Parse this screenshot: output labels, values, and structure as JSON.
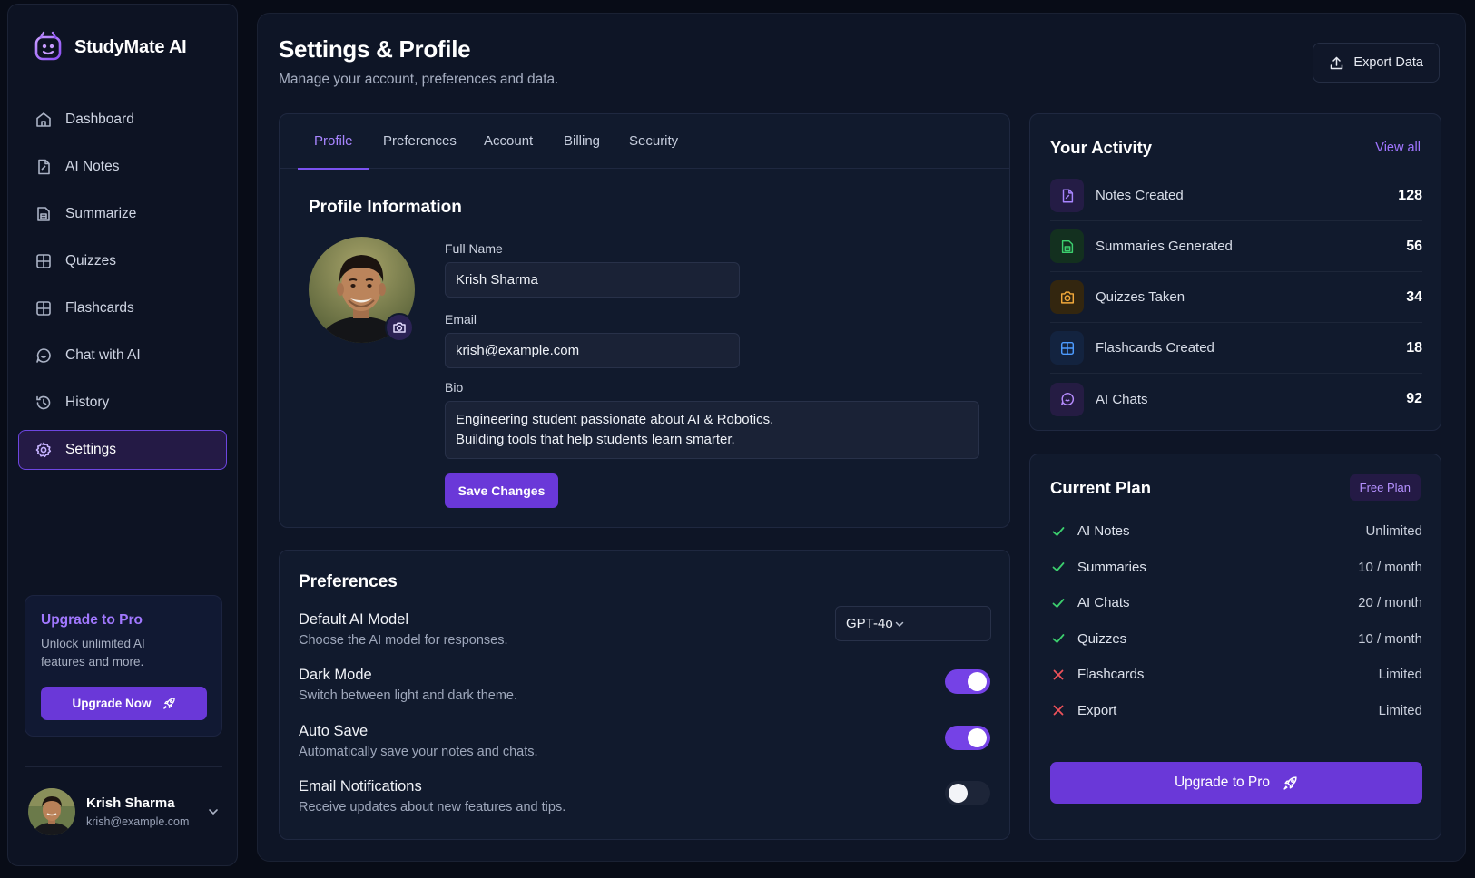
{
  "app": {
    "name": "StudyMate AI"
  },
  "sidebar": {
    "items": [
      {
        "label": "Dashboard",
        "icon": "home-icon"
      },
      {
        "label": "AI Notes",
        "icon": "note-icon"
      },
      {
        "label": "Summarize",
        "icon": "summarize-icon"
      },
      {
        "label": "Quizzes",
        "icon": "grid-icon"
      },
      {
        "label": "Flashcards",
        "icon": "grid-icon"
      },
      {
        "label": "Chat with AI",
        "icon": "chat-icon"
      },
      {
        "label": "History",
        "icon": "history-icon"
      },
      {
        "label": "Settings",
        "icon": "gear-icon",
        "active": true
      }
    ],
    "upgrade": {
      "title": "Upgrade to Pro",
      "description": "Unlock unlimited AI features and more.",
      "button": "Upgrade Now"
    },
    "user": {
      "name": "Krish Sharma",
      "email": "krish@example.com"
    }
  },
  "header": {
    "title": "Settings & Profile",
    "subtitle": "Manage your account, preferences and data.",
    "export_label": "Export Data"
  },
  "tabs": [
    "Profile",
    "Preferences",
    "Account",
    "Billing",
    "Security"
  ],
  "active_tab": "Profile",
  "profile": {
    "section_title": "Profile Information",
    "full_name_label": "Full Name",
    "full_name": "Krish Sharma",
    "email_label": "Email",
    "email": "krish@example.com",
    "bio_label": "Bio",
    "bio_line1": "Engineering student passionate about AI & Robotics.",
    "bio_line2": "Building tools that help students learn smarter.",
    "save_label": "Save Changes"
  },
  "preferences": {
    "title": "Preferences",
    "items": [
      {
        "name": "Default AI Model",
        "desc": "Choose the AI model for responses.",
        "type": "select",
        "value": "GPT-4o"
      },
      {
        "name": "Dark Mode",
        "desc": "Switch between light and dark theme.",
        "type": "toggle",
        "on": true
      },
      {
        "name": "Auto Save",
        "desc": "Automatically save your notes and chats.",
        "type": "toggle",
        "on": true
      },
      {
        "name": "Email Notifications",
        "desc": "Receive updates about new features and tips.",
        "type": "toggle",
        "on": false
      }
    ]
  },
  "activity": {
    "title": "Your Activity",
    "view_all": "View all",
    "items": [
      {
        "label": "Notes Created",
        "value": "128",
        "icon": "note-icon",
        "color": "#a885ff",
        "bg": "#241c45"
      },
      {
        "label": "Summaries Generated",
        "value": "56",
        "icon": "summarize-icon",
        "color": "#3ccf6e",
        "bg": "#13301f"
      },
      {
        "label": "Quizzes Taken",
        "value": "34",
        "icon": "quiz-icon",
        "color": "#f2a93b",
        "bg": "#33260f"
      },
      {
        "label": "Flashcards Created",
        "value": "18",
        "icon": "grid-icon",
        "color": "#4d9bff",
        "bg": "#13233f"
      },
      {
        "label": "AI Chats",
        "value": "92",
        "icon": "chat-icon",
        "color": "#b78cff",
        "bg": "#251c43"
      }
    ]
  },
  "plan": {
    "title": "Current Plan",
    "badge": "Free Plan",
    "features": [
      {
        "name": "AI Notes",
        "limit": "Unlimited",
        "included": true
      },
      {
        "name": "Summaries",
        "limit": "10 / month",
        "included": true
      },
      {
        "name": "AI Chats",
        "limit": "20 / month",
        "included": true
      },
      {
        "name": "Quizzes",
        "limit": "10 / month",
        "included": true
      },
      {
        "name": "Flashcards",
        "limit": "Limited",
        "included": false
      },
      {
        "name": "Export",
        "limit": "Limited",
        "included": false
      }
    ],
    "button": "Upgrade to Pro"
  },
  "colors": {
    "accent": "#6a38d8",
    "accent_text": "#a885ff",
    "check": "#3ccf6e",
    "cross": "#f0525a",
    "background": "#080c17"
  }
}
